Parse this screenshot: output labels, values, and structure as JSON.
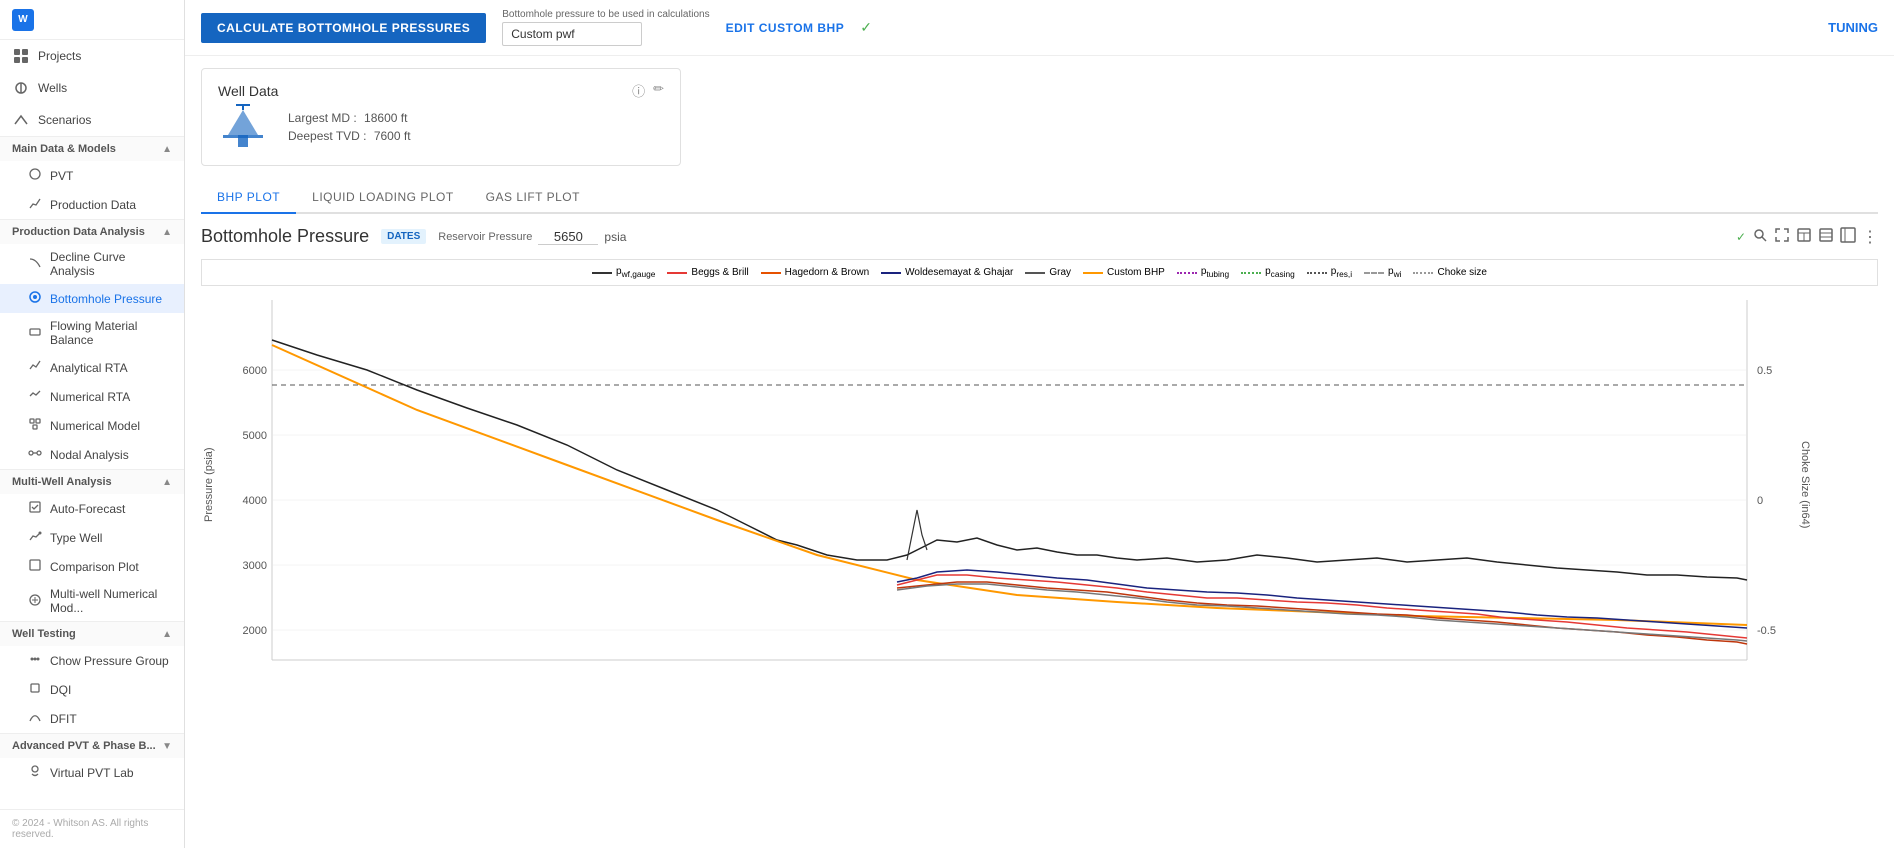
{
  "sidebar": {
    "logo": "W",
    "projects_label": "Projects",
    "wells_label": "Wells",
    "scenarios_label": "Scenarios",
    "main_data_section": "Main Data & Models",
    "pvt_label": "PVT",
    "production_data_label": "Production Data",
    "production_data_analysis_section": "Production Data Analysis",
    "decline_curve_label": "Decline Curve Analysis",
    "bottomhole_pressure_label": "Bottomhole Pressure",
    "flowing_material_balance_label": "Flowing Material Balance",
    "analytical_rta_label": "Analytical RTA",
    "numerical_rta_label": "Numerical RTA",
    "numerical_model_label": "Numerical Model",
    "nodal_analysis_label": "Nodal Analysis",
    "multi_well_section": "Multi-Well Analysis",
    "auto_forecast_label": "Auto-Forecast",
    "type_well_label": "Type Well",
    "comparison_plot_label": "Comparison Plot",
    "multi_well_numerical_label": "Multi-well Numerical Mod...",
    "well_testing_section": "Well Testing",
    "chow_pressure_label": "Chow Pressure Group",
    "dqi_label": "DQI",
    "dfit_label": "DFIT",
    "advanced_pvt_section": "Advanced PVT & Phase B...",
    "virtual_pvt_label": "Virtual PVT Lab",
    "footer": "© 2024 - Whitson AS. All rights reserved."
  },
  "topbar": {
    "calculate_btn": "CALCULATE BOTTOMHOLE PRESSURES",
    "bhp_label": "Bottomhole pressure to be used in calculations",
    "bhp_option": "Custom pwf",
    "edit_bhp_btn": "EDIT CUSTOM BHP",
    "tuning_btn": "TUNING"
  },
  "well_data": {
    "title": "Well Data",
    "largest_md_label": "Largest MD :",
    "largest_md_value": "18600 ft",
    "deepest_tvd_label": "Deepest TVD :",
    "deepest_tvd_value": "7600 ft"
  },
  "plot_tabs": [
    {
      "label": "BHP PLOT",
      "active": true
    },
    {
      "label": "LIQUID LOADING PLOT",
      "active": false
    },
    {
      "label": "GAS LIFT PLOT",
      "active": false
    }
  ],
  "bhp_section": {
    "title": "Bottomhole Pressure",
    "dates_badge": "DATES",
    "reservoir_pressure_label": "Reservoir Pressure",
    "reservoir_pressure_value": "5650",
    "reservoir_pressure_unit": "psia"
  },
  "legend": [
    {
      "label": "pwf,gauge",
      "color": "#333",
      "style": "solid"
    },
    {
      "label": "Beggs & Brill",
      "color": "#e53935",
      "style": "solid"
    },
    {
      "label": "Hagedorn & Brown",
      "color": "#e65100",
      "style": "solid"
    },
    {
      "label": "Woldesemayat & Ghajar",
      "color": "#1a237e",
      "style": "solid"
    },
    {
      "label": "Gray",
      "color": "#555",
      "style": "solid"
    },
    {
      "label": "Custom BHP",
      "color": "#ff9800",
      "style": "solid"
    },
    {
      "label": "ptubing",
      "color": "#9c27b0",
      "style": "dotted"
    },
    {
      "label": "pcasing",
      "color": "#4caf50",
      "style": "dotted"
    },
    {
      "label": "pres,i",
      "color": "#555",
      "style": "dotted"
    },
    {
      "label": "pwi",
      "color": "#999",
      "style": "dashed"
    },
    {
      "label": "Choke size",
      "color": "#999",
      "style": "dotted"
    }
  ],
  "chart": {
    "y_axis_label": "Pressure (psia)",
    "y_axis_right_label": "Choke Size (in64)",
    "y_ticks": [
      "6000",
      "5000",
      "4000",
      "3000",
      "2000"
    ],
    "y_right_ticks": [
      "0.5",
      "0",
      "-0.5"
    ]
  }
}
